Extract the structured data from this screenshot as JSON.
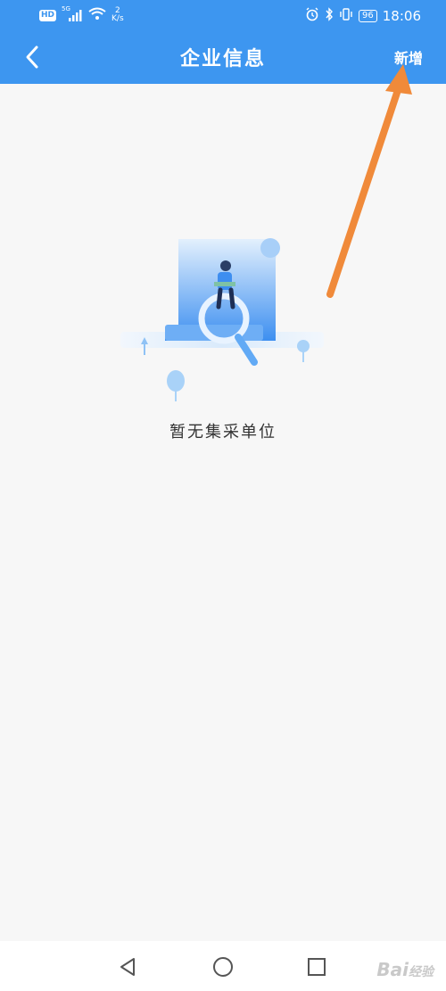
{
  "status_bar": {
    "network_badge": "HD",
    "signal_tag": "5G",
    "net_speed_value": "2",
    "net_speed_unit": "K/s",
    "battery": "96",
    "time": "18:06"
  },
  "header": {
    "title": "企业信息",
    "add_label": "新增",
    "back_icon": "chevron-left-icon"
  },
  "empty_state": {
    "message": "暂无集采单位",
    "illustration": "person-on-document-with-magnifier-illustration"
  },
  "system_nav": {
    "back_icon": "triangle-back-icon",
    "home_icon": "circle-home-icon",
    "recent_icon": "square-recents-icon"
  },
  "watermark": {
    "brand": "Bai",
    "suffix": "经验"
  },
  "colors": {
    "header_bg": "#3d96f0",
    "page_bg": "#f7f7f7",
    "annotation_arrow": "#f08a3a"
  }
}
